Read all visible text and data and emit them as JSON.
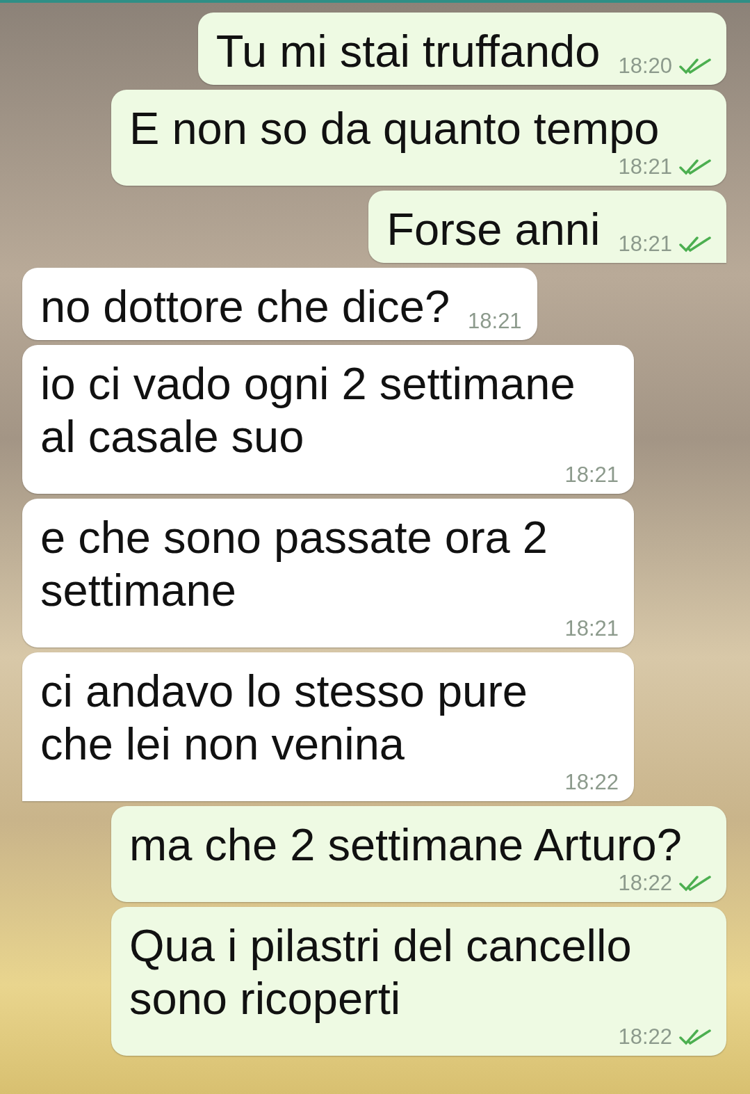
{
  "messages": [
    {
      "kind": "sent",
      "text": "Tu mi stai truffando",
      "time": "18:20",
      "read": true,
      "tail": false
    },
    {
      "kind": "sent",
      "text": "E non so da quanto tempo",
      "time": "18:21",
      "read": true,
      "tail": false
    },
    {
      "kind": "sent",
      "text": "Forse anni",
      "time": "18:21",
      "read": true,
      "tail": true
    },
    {
      "kind": "received",
      "text": "no dottore che dice?",
      "time": "18:21",
      "tail": false
    },
    {
      "kind": "received",
      "text": "io ci vado ogni 2 settimane al casale suo",
      "time": "18:21",
      "tail": false
    },
    {
      "kind": "received",
      "text": "e che sono passate ora 2 settimane",
      "time": "18:21",
      "tail": false
    },
    {
      "kind": "received",
      "text": "ci andavo lo stesso pure che lei non venina",
      "time": "18:22",
      "tail": true
    },
    {
      "kind": "sent",
      "text": "ma che 2 settimane Arturo?",
      "time": "18:22",
      "read": true,
      "tail": false
    },
    {
      "kind": "sent",
      "text": "Qua i pilastri del cancello sono ricoperti",
      "time": "18:22",
      "read": true,
      "tail": false
    }
  ]
}
